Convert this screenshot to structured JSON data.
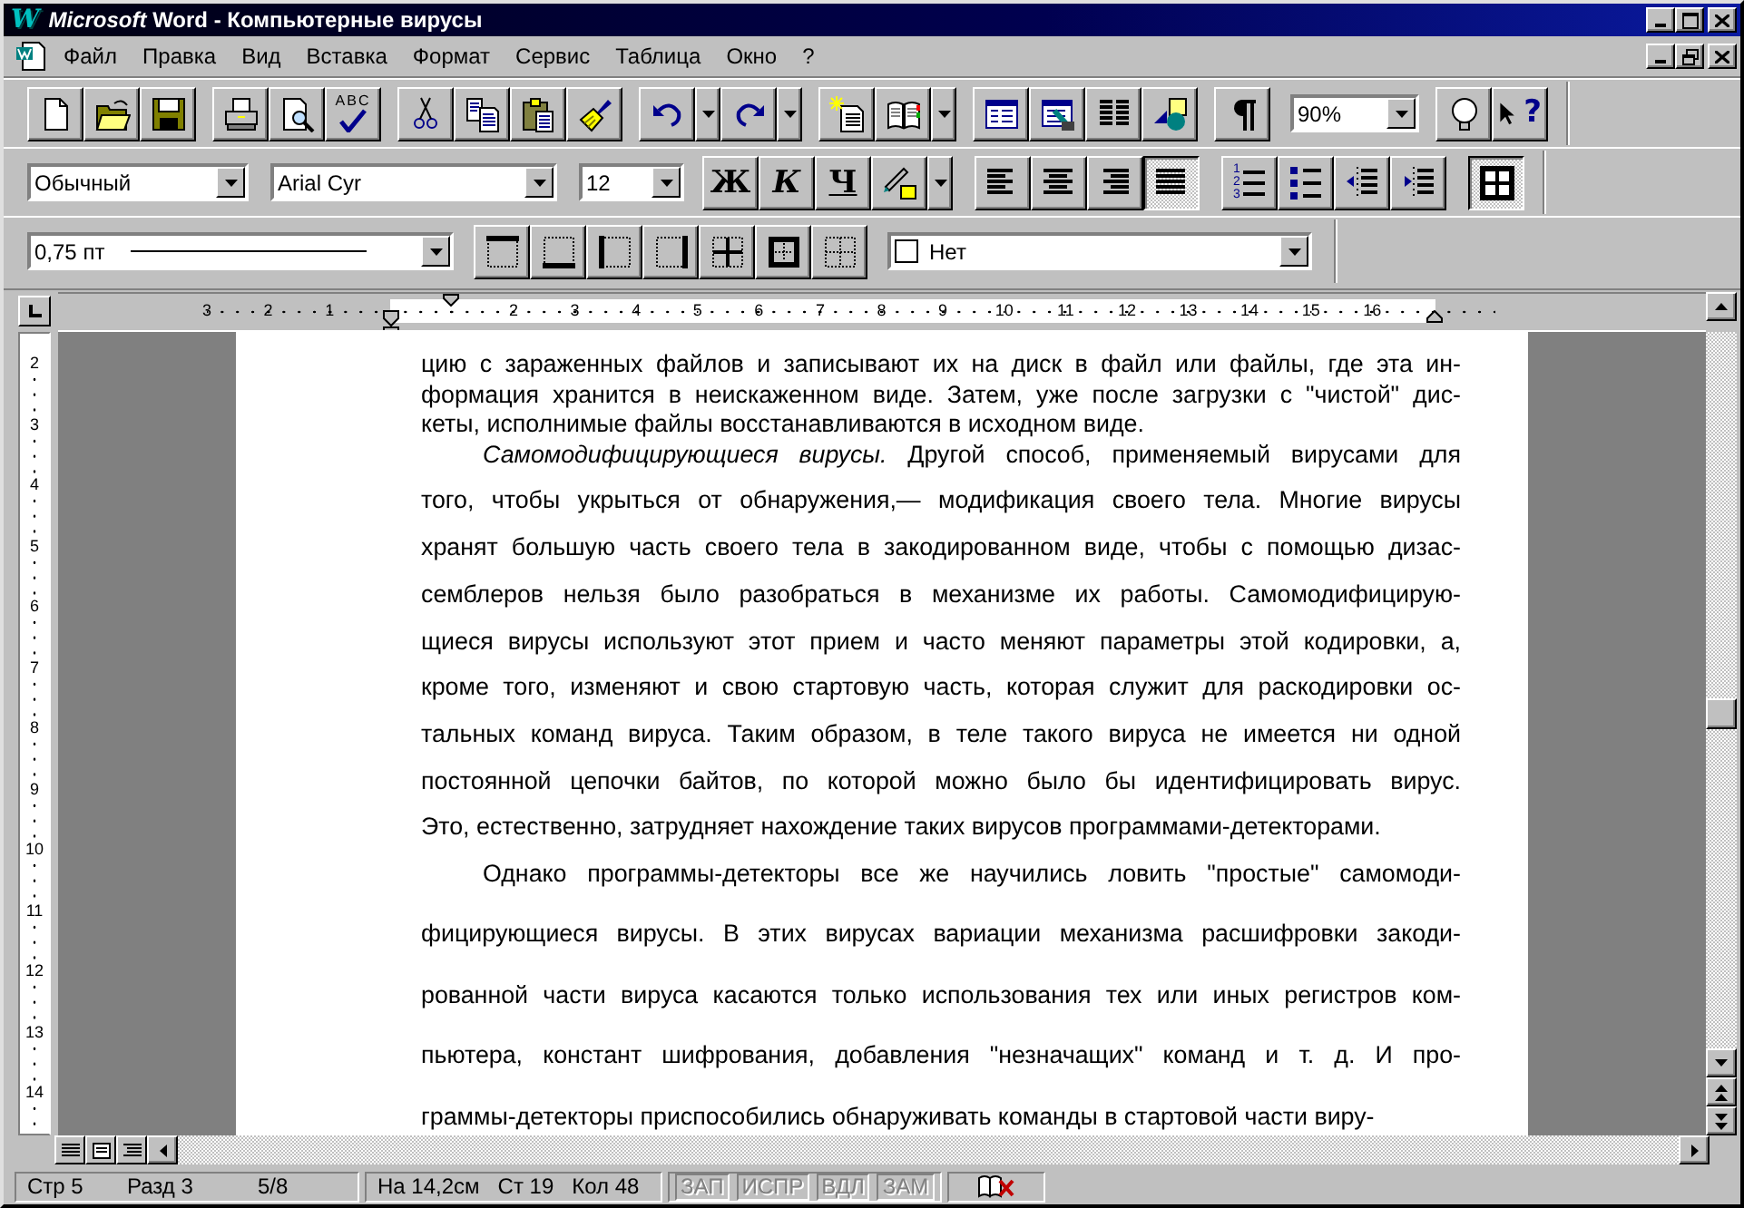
{
  "window": {
    "app_letter": "W",
    "title": "*Microsoft* Word - Компьютерные вирусы"
  },
  "menu": [
    "Файл",
    "Правка",
    "Вид",
    "Вставка",
    "Формат",
    "Сервис",
    "Таблица",
    "Окно",
    "?"
  ],
  "standard_toolbar": {
    "spell_label": "ABC",
    "zoom": "90%",
    "help_mark": "?"
  },
  "formatting_toolbar": {
    "style": "Обычный",
    "font": "Arial Cyr",
    "size": "12",
    "text_buttons": [
      {
        "label": "Ж",
        "on": false
      },
      {
        "label": "К",
        "on": false
      },
      {
        "label": "Ч",
        "on": false
      }
    ],
    "alignment": [
      {
        "selected": false
      },
      {
        "selected": false
      },
      {
        "selected": false
      },
      {
        "selected": true
      }
    ],
    "numbered_list_digits": [
      "1",
      "2",
      "3"
    ],
    "borders_on": true
  },
  "borders_toolbar": {
    "line_width": "0,75 пт",
    "shading": "Нет"
  },
  "ruler": {
    "left_labels": [
      "3",
      "2",
      "1"
    ],
    "labels": [
      "2",
      "3",
      "4",
      "5",
      "6",
      "7",
      "8",
      "9",
      "10",
      "11",
      "12",
      "13",
      "14",
      "15",
      "16"
    ]
  },
  "vertical_ruler": {
    "labels": [
      "2",
      "3",
      "4",
      "5",
      "6",
      "7",
      "8",
      "9",
      "10",
      "11",
      "12",
      "13",
      "14"
    ]
  },
  "document": {
    "paragraphs": [
      {
        "kind": "single",
        "indent": false,
        "lines": [
          "цию с зараженных файлов и записывают их на диск в файл или файлы, где эта ин-",
          "формация хранится в неискаженном виде. Затем, уже после загрузки с \"чистой\" дис-",
          "кеты, исполнимые файлы восстанавливаются в исходном виде."
        ]
      },
      {
        "kind": "one_and_half",
        "indent": true,
        "lines": [
          "*Самомодифицирующиеся вирусы.* Другой способ, применяемый вирусами для",
          "того, чтобы укрыться от обнаружения,— модификация своего тела. Многие вирусы",
          "хранят большую часть своего тела в закодированном виде, чтобы с помощью дизас-",
          "семблеров нельзя было разобраться в механизме их работы. Самомодифицирую-",
          "щиеся вирусы используют этот прием и часто меняют параметры этой кодировки, а,",
          "кроме того, изменяют и свою стартовую часть, которая служит для раскодировки ос-",
          "тальных команд вируса. Таким образом, в теле такого вируса не имеется ни одной",
          "постоянной цепочки байтов, по которой можно было бы идентифицировать вирус.",
          "Это, естественно, затрудняет нахождение таких вирусов программами-детекторами."
        ]
      },
      {
        "kind": "double",
        "indent": true,
        "lines": [
          "Однако программы-детекторы все же научились ловить \"простые\" самомоди-",
          "фицирующиеся вирусы. В этих вирусах вариации механизма расшифровки закоди-",
          "рованной части вируса касаются только использования тех или иных регистров ком-",
          "пьютера, констант шифрования, добавления \"незначащих\" команд и т. д. И про-",
          "граммы-детекторы приспособились обнаруживать команды в стартовой части виру-"
        ]
      }
    ]
  },
  "status_bar": {
    "sections": [
      {
        "items": [
          {
            "text": "Стр 5",
            "disabled": false
          },
          {
            "text": "Разд 3",
            "disabled": false
          },
          {
            "text": "5/8",
            "disabled": false
          }
        ]
      },
      {
        "items": [
          {
            "text": "На 14,2см",
            "disabled": false
          },
          {
            "text": "Ст 19",
            "disabled": false
          },
          {
            "text": "Кол 48",
            "disabled": false
          }
        ]
      },
      {
        "items": [
          {
            "text": "ЗАП",
            "disabled": true
          },
          {
            "text": "ИСПР",
            "disabled": true
          },
          {
            "text": "ВДЛ",
            "disabled": true
          },
          {
            "text": "ЗАМ",
            "disabled": true
          }
        ]
      }
    ]
  }
}
